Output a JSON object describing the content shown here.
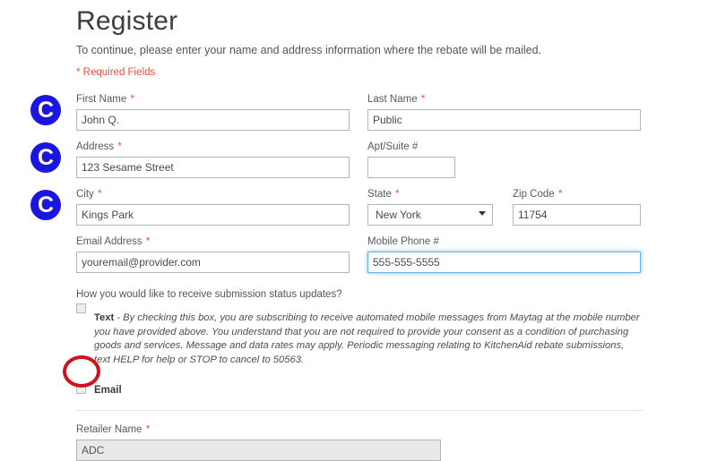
{
  "header": {
    "title": "Register",
    "intro": "To continue, please enter your name and address information where the rebate will be mailed.",
    "required_note": "* Required Fields"
  },
  "form": {
    "first_name": {
      "label": "First Name",
      "required": "*",
      "value": "John Q.",
      "placeholder": "First Name"
    },
    "last_name": {
      "label": "Last Name",
      "required": "*",
      "value": "Public",
      "placeholder": "Last Name"
    },
    "address": {
      "label": "Address",
      "required": "*",
      "value": "123 Sesame Street",
      "placeholder": "Address"
    },
    "apt_suite": {
      "label": "Apt/Suite #",
      "required": "",
      "value": "",
      "placeholder": ""
    },
    "city": {
      "label": "City",
      "required": "*",
      "value": "Kings Park",
      "placeholder": "City"
    },
    "state": {
      "label": "State",
      "required": "*",
      "value": "New York",
      "options": [
        "New York"
      ]
    },
    "zip_code": {
      "label": "Zip Code",
      "required": "*",
      "value": "11754",
      "placeholder": "Zip Code"
    },
    "email_address": {
      "label": "Email Address",
      "required": "*",
      "value": "youremail@provider.com",
      "placeholder": "youremail@provider.com"
    },
    "mobile_phone": {
      "label": "Mobile Phone #",
      "required": "",
      "value": "555-555-5555",
      "placeholder": "555-555-5555"
    },
    "retailer_name": {
      "label": "Retailer Name",
      "required": "*",
      "value": "ADC",
      "placeholder": "Retailer Name"
    }
  },
  "updates": {
    "question": "How you would like to receive submission status updates?",
    "text_option": {
      "lead": "Text",
      "separator": " - ",
      "body": "By checking this box, you are subscribing to receive automated mobile messages from Maytag at the mobile number you have provided above. You understand that you are not required to provide your consent as a condition of purchasing goods and services. Message and data rates may apply. Periodic messaging relating to KitchenAid rebate submissions, text HELP for help or STOP to cancel to 50563.",
      "checked": false
    },
    "email_option": {
      "label": "Email",
      "checked": false
    }
  },
  "annotations": {
    "cursor_badges": [
      {
        "glyph": "C",
        "name": "cursor-badge-first-name"
      },
      {
        "glyph": "C",
        "name": "cursor-badge-address"
      },
      {
        "glyph": "C",
        "name": "cursor-badge-city"
      }
    ],
    "highlight_ring": {
      "name": "email-checkbox-highlight",
      "color": "#d1121a"
    }
  },
  "colors": {
    "required_asterisk": "#e8503a",
    "badge_blue": "#1a16e0",
    "highlight_red": "#d1121a",
    "focus_blue": "#66afe9",
    "label_gray": "#58585a"
  }
}
